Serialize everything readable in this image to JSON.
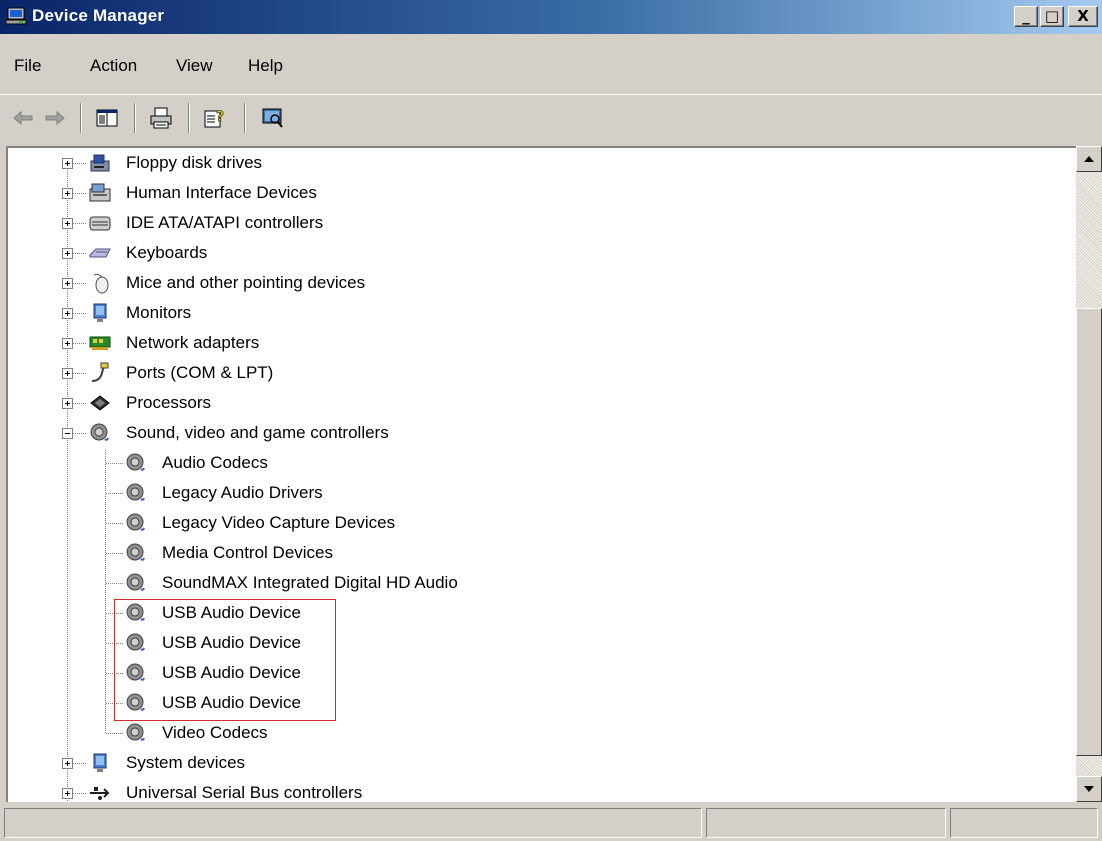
{
  "window": {
    "title": "Device Manager",
    "minimize_glyph": "_",
    "maximize_glyph": "□",
    "close_glyph": "X"
  },
  "menu": [
    "File",
    "Action",
    "View",
    "Help"
  ],
  "toolbar": {
    "buttons": [
      "back-arrow-icon",
      "forward-arrow-icon",
      "show-hide-console-tree-icon",
      "print-icon",
      "help-properties-icon",
      "scan-hardware-icon"
    ]
  },
  "tree": {
    "categories": [
      {
        "label": "Floppy disk drives",
        "icon": "floppy-drive-icon",
        "expanded": false
      },
      {
        "label": "Human Interface Devices",
        "icon": "hid-icon",
        "expanded": false
      },
      {
        "label": "IDE ATA/ATAPI controllers",
        "icon": "ide-controller-icon",
        "expanded": false
      },
      {
        "label": "Keyboards",
        "icon": "keyboard-icon",
        "expanded": false
      },
      {
        "label": "Mice and other pointing devices",
        "icon": "mouse-icon",
        "expanded": false
      },
      {
        "label": "Monitors",
        "icon": "monitor-icon",
        "expanded": false
      },
      {
        "label": "Network adapters",
        "icon": "network-adapter-icon",
        "expanded": false
      },
      {
        "label": "Ports (COM & LPT)",
        "icon": "port-icon",
        "expanded": false
      },
      {
        "label": "Processors",
        "icon": "processor-icon",
        "expanded": false
      },
      {
        "label": "Sound, video and game controllers",
        "icon": "speaker-icon",
        "expanded": true
      },
      {
        "label": "System devices",
        "icon": "system-device-icon",
        "expanded": false
      },
      {
        "label": "Universal Serial Bus controllers",
        "icon": "usb-icon",
        "expanded": false
      }
    ],
    "sound_children": [
      "Audio Codecs",
      "Legacy Audio Drivers",
      "Legacy Video Capture Devices",
      "Media Control Devices",
      "SoundMAX Integrated Digital HD Audio",
      "USB Audio Device",
      "USB Audio Device",
      "USB Audio Device",
      "USB Audio Device",
      "Video Codecs"
    ]
  },
  "colors": {
    "highlight_box": "#d62a2a",
    "titlebar_start": "#0a246a",
    "titlebar_end": "#a6caf0"
  }
}
